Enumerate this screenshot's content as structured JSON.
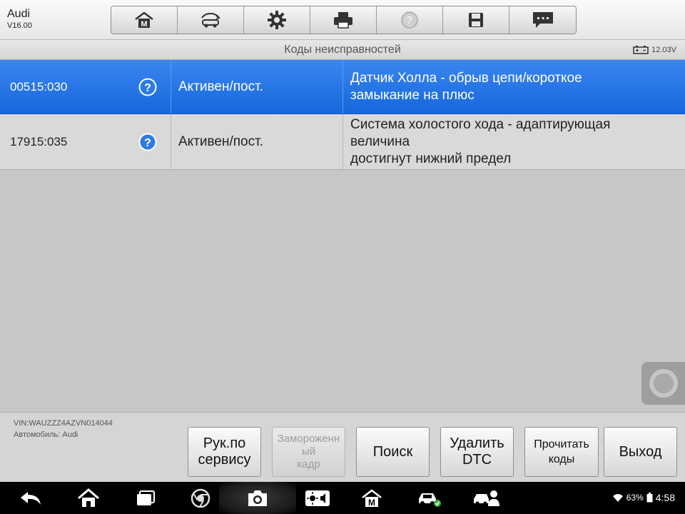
{
  "header": {
    "make": "Audi",
    "version": "V16.00",
    "toolbar": [
      {
        "name": "home-icon",
        "enabled": true
      },
      {
        "name": "vehicle-swap-icon",
        "enabled": true
      },
      {
        "name": "gear-icon",
        "enabled": true
      },
      {
        "name": "printer-icon",
        "enabled": true
      },
      {
        "name": "help-icon",
        "enabled": false
      },
      {
        "name": "save-icon",
        "enabled": true
      },
      {
        "name": "message-icon",
        "enabled": true
      }
    ]
  },
  "titlebar": {
    "title": "Коды неисправностей",
    "voltage": "12.03V"
  },
  "dtc": [
    {
      "code": "00515:030",
      "status": "Активен/пост.",
      "desc_lines": [
        "Датчик Холла - обрыв цепи/короткое",
        "замыкание на плюс"
      ],
      "selected": true
    },
    {
      "code": "17915:035",
      "status": "Активен/пост.",
      "desc_lines": [
        "Система холостого хода - адаптирующая",
        "величина",
        "достигнут нижний предел"
      ],
      "selected": false
    }
  ],
  "footer": {
    "vin": "VIN:WAUZZZ4AZVN014044",
    "vehicle": "Автомобиль: Audi",
    "buttons": {
      "manual": "Рук.по\nсервису",
      "freeze": "Замороженн\nый\nкадр",
      "search": "Поиск",
      "clear": "Удалить\nDTC",
      "read": "Прочитать\nкоды",
      "exit": "Выход"
    }
  },
  "statusbar": {
    "battery": "63%",
    "time": "4:58"
  },
  "colors": {
    "selected_row": "#1f6fe3",
    "background": "#c7c7c7"
  }
}
